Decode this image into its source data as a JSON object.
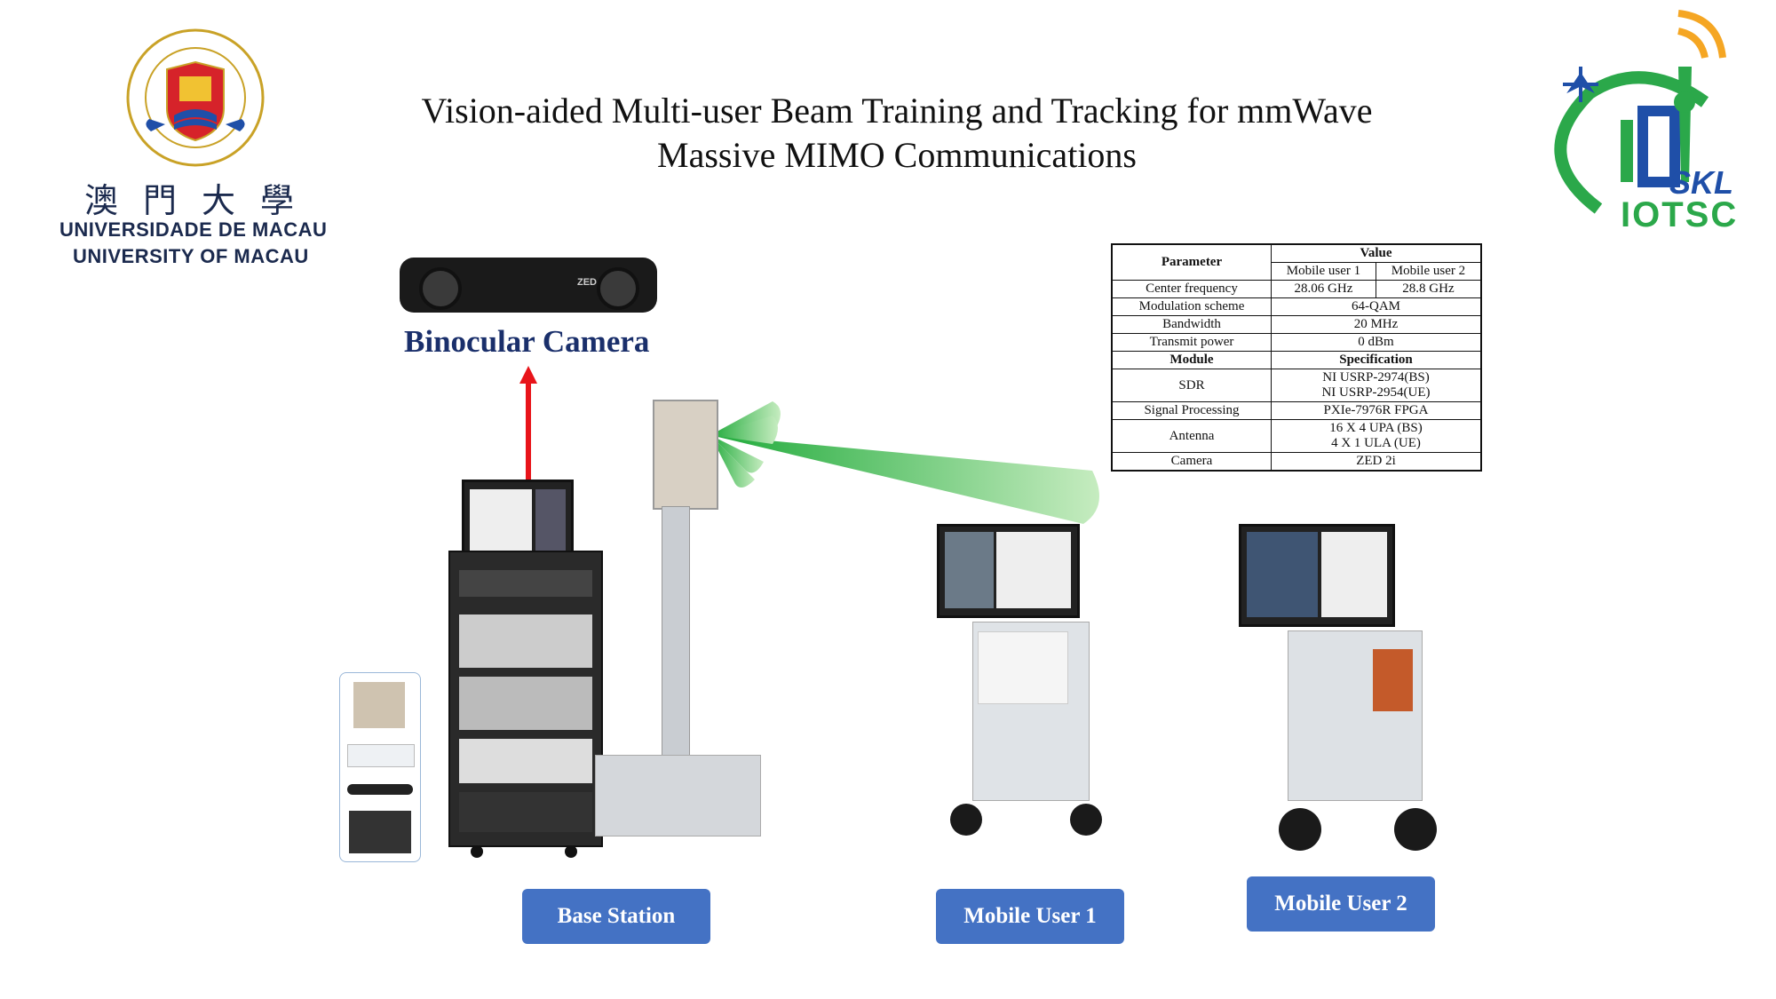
{
  "title": {
    "line1": "Vision-aided Multi-user Beam Training and Tracking for mmWave",
    "line2": "Massive MIMO Communications"
  },
  "university": {
    "name_cn": "澳門大學",
    "name_pt": "UNIVERSIDADE DE MACAU",
    "name_en": "UNIVERSITY OF MACAU",
    "seal_text": "UNIVERSIDADE DE MACAU"
  },
  "lab_logo": {
    "line1": "SKL",
    "line2": "IOTSC",
    "colors": {
      "green": "#2ba84a",
      "blue": "#1f4fa8",
      "orange": "#f5a623"
    }
  },
  "camera": {
    "label": "Binocular Camera",
    "brand": "ZED"
  },
  "spec_table": {
    "header_parameter": "Parameter",
    "header_value": "Value",
    "col_user1": "Mobile user 1",
    "col_user2": "Mobile user 2",
    "rows_top": [
      {
        "param": "Center frequency",
        "user1": "28.06 GHz",
        "user2": "28.8 GHz"
      },
      {
        "param": "Modulation scheme",
        "value": "64-QAM"
      },
      {
        "param": "Bandwidth",
        "value": "20 MHz"
      },
      {
        "param": "Transmit power",
        "value": "0 dBm"
      }
    ],
    "header_module": "Module",
    "header_spec": "Specification",
    "rows_bottom": [
      {
        "param": "SDR",
        "line1": "NI USRP-2974(BS)",
        "line2": "NI USRP-2954(UE)"
      },
      {
        "param": "Signal Processing",
        "line1": "PXIe-7976R FPGA"
      },
      {
        "param": "Antenna",
        "line1": "16 X 4 UPA (BS)",
        "line2": "4 X 1 ULA (UE)"
      },
      {
        "param": "Camera",
        "line1": "ZED 2i"
      }
    ]
  },
  "buttons": {
    "base_station": "Base Station",
    "mobile_user_1": "Mobile User 1",
    "mobile_user_2": "Mobile User 2"
  },
  "colors": {
    "button": "#4472c4",
    "beam": "#3cb44b",
    "arrow": "#e8141a",
    "label": "#1a2f6b"
  }
}
